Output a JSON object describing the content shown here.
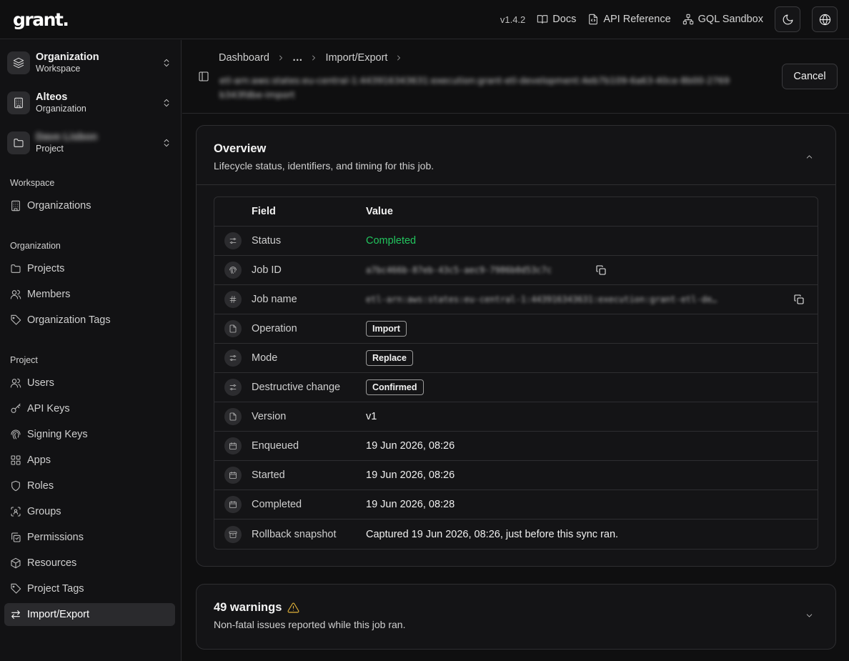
{
  "app": {
    "logo": "grant."
  },
  "topbar": {
    "version": "v1.4.2",
    "links": [
      {
        "label": "Docs",
        "icon": "book-icon"
      },
      {
        "label": "API Reference",
        "icon": "file-code-icon"
      },
      {
        "label": "GQL Sandbox",
        "icon": "network-icon"
      }
    ]
  },
  "sidebar": {
    "switchers": [
      {
        "name": "Organization",
        "sub": "Workspace",
        "icon": "layers-icon"
      },
      {
        "name": "Alteos",
        "sub": "Organization",
        "icon": "building-icon"
      },
      {
        "name": "Dave Lisbon",
        "sub": "Project",
        "icon": "folder-icon"
      }
    ],
    "sections": [
      {
        "label": "Workspace",
        "items": [
          {
            "label": "Organizations",
            "icon": "building-icon"
          }
        ]
      },
      {
        "label": "Organization",
        "items": [
          {
            "label": "Projects",
            "icon": "folder-icon"
          },
          {
            "label": "Members",
            "icon": "users-icon"
          },
          {
            "label": "Organization Tags",
            "icon": "tag-icon"
          }
        ]
      },
      {
        "label": "Project",
        "items": [
          {
            "label": "Users",
            "icon": "users-icon"
          },
          {
            "label": "API Keys",
            "icon": "key-icon"
          },
          {
            "label": "Signing Keys",
            "icon": "fingerprint-icon"
          },
          {
            "label": "Apps",
            "icon": "grid-icon"
          },
          {
            "label": "Roles",
            "icon": "shield-icon"
          },
          {
            "label": "Groups",
            "icon": "group-icon"
          },
          {
            "label": "Permissions",
            "icon": "permissions-icon"
          },
          {
            "label": "Resources",
            "icon": "box-icon"
          },
          {
            "label": "Project Tags",
            "icon": "tag-icon"
          },
          {
            "label": "Import/Export",
            "icon": "arrows-icon",
            "active": true
          }
        ]
      }
    ]
  },
  "header": {
    "breadcrumb": [
      "Dashboard",
      "…",
      "Import/Export"
    ],
    "job_arn": "etl-arn:aws:states:eu-central-1:443916343631:execution:grant-etl-development:4eb7b109-6a63-40ce-8b00-2769b343fdbe-import",
    "cancel_label": "Cancel"
  },
  "overview": {
    "title": "Overview",
    "description": "Lifecycle status, identifiers, and timing for this job.",
    "columns": {
      "field": "Field",
      "value": "Value"
    },
    "rows": [
      {
        "field": "Status",
        "value": "Completed",
        "kind": "status",
        "icon": "sliders-icon"
      },
      {
        "field": "Job ID",
        "value": "a7bc466b-87eb-43c5-aec9-7986b0d53c7c",
        "kind": "blur-copy",
        "icon": "fingerprint-icon"
      },
      {
        "field": "Job name",
        "value": "etl-arn:aws:states:eu-central-1:443916343631:execution:grant-etl-de…",
        "kind": "blur-copy-right",
        "icon": "hash-icon"
      },
      {
        "field": "Operation",
        "value": "Import",
        "kind": "badge",
        "icon": "file-icon"
      },
      {
        "field": "Mode",
        "value": "Replace",
        "kind": "badge",
        "icon": "sliders-icon"
      },
      {
        "field": "Destructive change",
        "value": "Confirmed",
        "kind": "badge",
        "icon": "sliders-icon"
      },
      {
        "field": "Version",
        "value": "v1",
        "kind": "text",
        "icon": "file-icon"
      },
      {
        "field": "Enqueued",
        "value": "19 Jun 2026, 08:26",
        "kind": "text",
        "icon": "calendar-icon"
      },
      {
        "field": "Started",
        "value": "19 Jun 2026, 08:26",
        "kind": "text",
        "icon": "calendar-icon"
      },
      {
        "field": "Completed",
        "value": "19 Jun 2026, 08:28",
        "kind": "text",
        "icon": "calendar-icon"
      },
      {
        "field": "Rollback snapshot",
        "value": "Captured 19 Jun 2026, 08:26, just before this sync ran.",
        "kind": "text",
        "icon": "archive-icon"
      }
    ]
  },
  "warnings": {
    "title": "49 warnings",
    "description": "Non-fatal issues reported while this job ran."
  },
  "colors": {
    "success": "#22c55e",
    "warning": "#e3b43a",
    "background": "#0f0f10"
  }
}
